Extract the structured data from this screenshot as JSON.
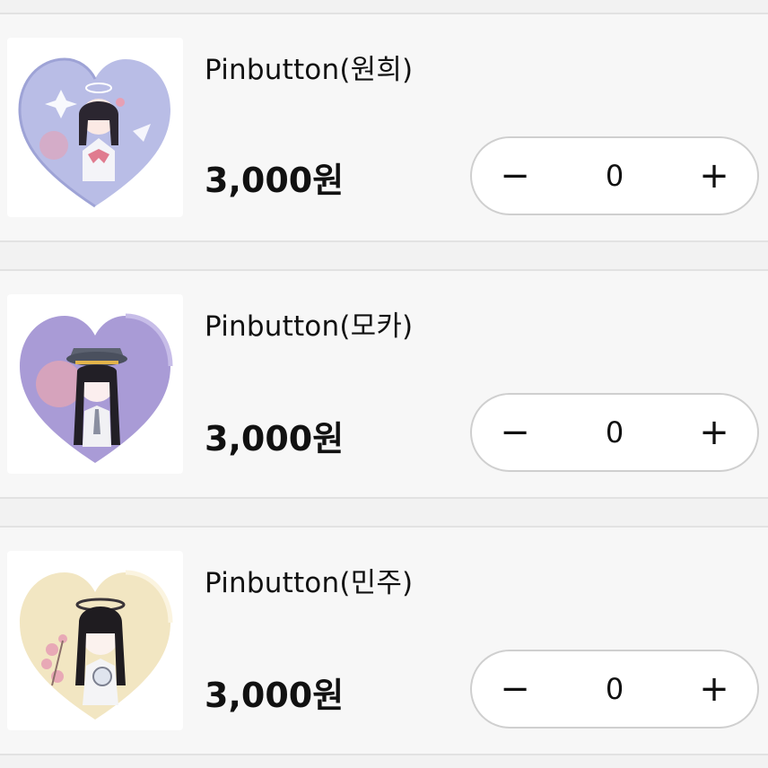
{
  "products": [
    {
      "title": "Pinbutton(원희)",
      "price": "3,000원",
      "quantity": "0",
      "minus_label": "−",
      "plus_label": "+",
      "thumb_colors": {
        "heart": "#b9bde6",
        "accent": "#e6a0b4"
      }
    },
    {
      "title": "Pinbutton(모카)",
      "price": "3,000원",
      "quantity": "0",
      "minus_label": "−",
      "plus_label": "+",
      "thumb_colors": {
        "heart": "#a99bd6",
        "accent": "#e9a7b0"
      }
    },
    {
      "title": "Pinbutton(민주)",
      "price": "3,000원",
      "quantity": "0",
      "minus_label": "−",
      "plus_label": "+",
      "thumb_colors": {
        "heart": "#f2e6c2",
        "accent": "#e8a9b6"
      }
    }
  ]
}
